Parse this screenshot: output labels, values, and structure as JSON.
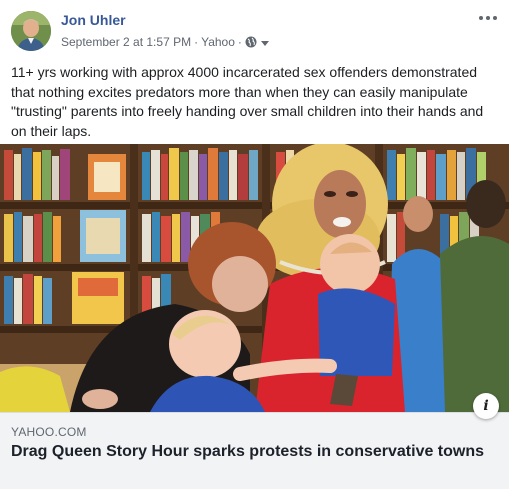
{
  "post": {
    "author": "Jon Uhler",
    "date": "September 2 at 1:57 PM",
    "separator": "·",
    "source": "Yahoo",
    "privacy_icon": "globe-icon",
    "menu_icon": "more-options-icon",
    "text": "11+ yrs working with approx 4000 incarcerated sex offenders demonstrated that nothing excites predators more than when they can easily manipulate \"trusting\" parents into freely handing over small children into their hands and on their laps."
  },
  "link_preview": {
    "domain": "YAHOO.COM",
    "headline": "Drag Queen Story Hour sparks protests in conservative towns",
    "info_icon": "info-icon",
    "info_label": "i"
  },
  "colors": {
    "author": "#385898",
    "meta": "#606770",
    "preview_bg": "#f2f3f5"
  }
}
